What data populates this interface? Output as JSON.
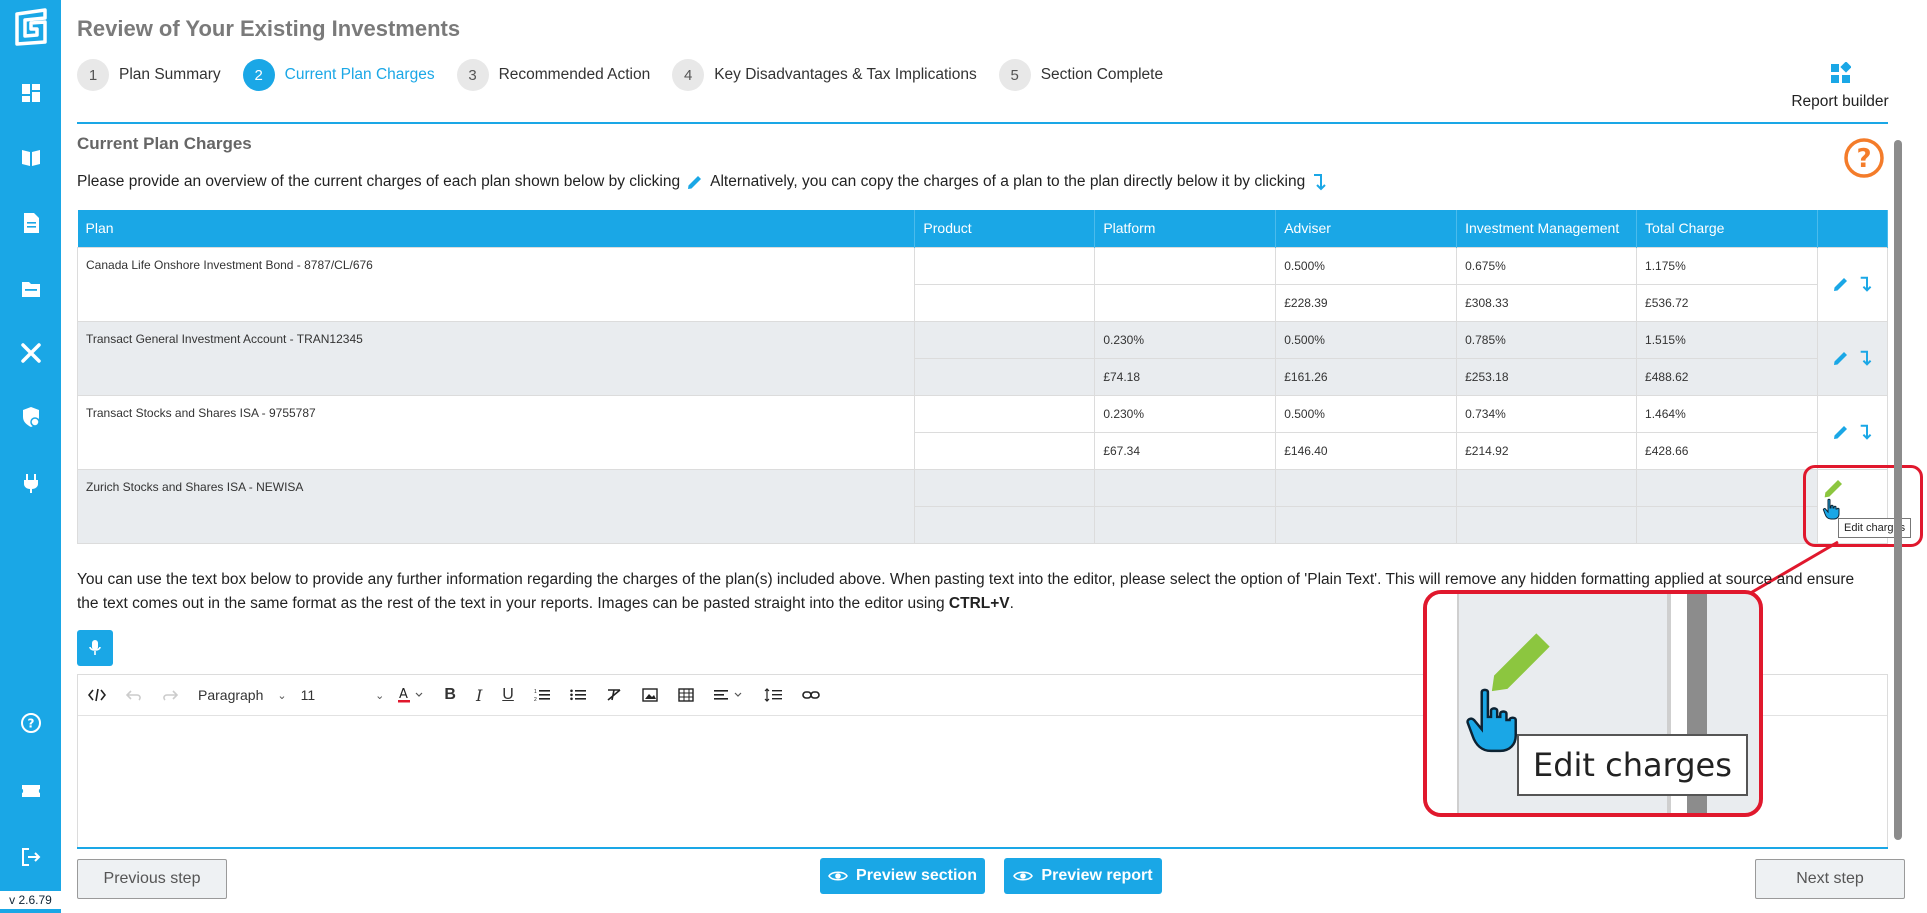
{
  "app": {
    "version": "v 2.6.79"
  },
  "sidebar": {
    "items": [
      {
        "icon": "dashboard-icon"
      },
      {
        "icon": "book-icon"
      },
      {
        "icon": "document-icon"
      },
      {
        "icon": "folder-icon"
      },
      {
        "icon": "tools-icon"
      },
      {
        "icon": "shield-icon"
      },
      {
        "icon": "plug-icon"
      },
      {
        "icon": "help-icon"
      },
      {
        "icon": "ticket-icon"
      },
      {
        "icon": "logout-icon"
      }
    ]
  },
  "header": {
    "title": "Review of Your Existing Investments",
    "report_builder_label": "Report builder"
  },
  "steps": [
    {
      "num": "1",
      "label": "Plan Summary",
      "active": false
    },
    {
      "num": "2",
      "label": "Current Plan Charges",
      "active": true
    },
    {
      "num": "3",
      "label": "Recommended Action",
      "active": false
    },
    {
      "num": "4",
      "label": "Key Disadvantages & Tax Implications",
      "active": false
    },
    {
      "num": "5",
      "label": "Section Complete",
      "active": false
    }
  ],
  "section": {
    "title": "Current Plan Charges",
    "instruction_part1": "Please provide an overview of the current charges of each plan shown below by clicking",
    "instruction_part2": "Alternatively, you can copy the charges of a plan to the plan directly below it by clicking"
  },
  "table": {
    "headers": [
      "Plan",
      "Product",
      "Platform",
      "Adviser",
      "Investment Management",
      "Total Charge",
      ""
    ],
    "plans": [
      {
        "name": "Canada Life Onshore Investment Bond - 8787/CL/676",
        "pct": {
          "product": "",
          "platform": "",
          "adviser": "0.500%",
          "investment": "0.675%",
          "total": "1.175%"
        },
        "amt": {
          "product": "",
          "platform": "",
          "adviser": "£228.39",
          "investment": "£308.33",
          "total": "£536.72"
        }
      },
      {
        "name": "Transact General Investment Account - TRAN12345",
        "pct": {
          "product": "",
          "platform": "0.230%",
          "adviser": "0.500%",
          "investment": "0.785%",
          "total": "1.515%"
        },
        "amt": {
          "product": "",
          "platform": "£74.18",
          "adviser": "£161.26",
          "investment": "£253.18",
          "total": "£488.62"
        }
      },
      {
        "name": "Transact Stocks and Shares ISA - 9755787",
        "pct": {
          "product": "",
          "platform": "0.230%",
          "adviser": "0.500%",
          "investment": "0.734%",
          "total": "1.464%"
        },
        "amt": {
          "product": "",
          "platform": "£67.34",
          "adviser": "£146.40",
          "investment": "£214.92",
          "total": "£428.66"
        }
      },
      {
        "name": "Zurich Stocks and Shares ISA - NEWISA",
        "pct": {
          "product": "",
          "platform": "",
          "adviser": "",
          "investment": "",
          "total": ""
        },
        "amt": {
          "product": "",
          "platform": "",
          "adviser": "",
          "investment": "",
          "total": ""
        }
      }
    ]
  },
  "info": {
    "text": "You can use the text box below to provide any further information regarding the charges of the plan(s) included above. When pasting text into the editor, please select the option of 'Plain Text'. This will remove any hidden formatting applied at source and ensure the text comes out in the same format as the rest of the text in your reports. Images can be pasted straight into the editor using ",
    "shortcut": "CTRL+V",
    "end": "."
  },
  "editor": {
    "block_format": "Paragraph",
    "font_size": "11"
  },
  "tooltip": {
    "label": "Edit charges"
  },
  "footer": {
    "previous": "Previous step",
    "preview_section": "Preview section",
    "preview_report": "Preview report",
    "next": "Next step"
  },
  "colors": {
    "accent": "#1aa7e6",
    "highlight_pencil": "#8cc63f",
    "callout_red": "#e0182d",
    "help_orange": "#f47c2a"
  }
}
